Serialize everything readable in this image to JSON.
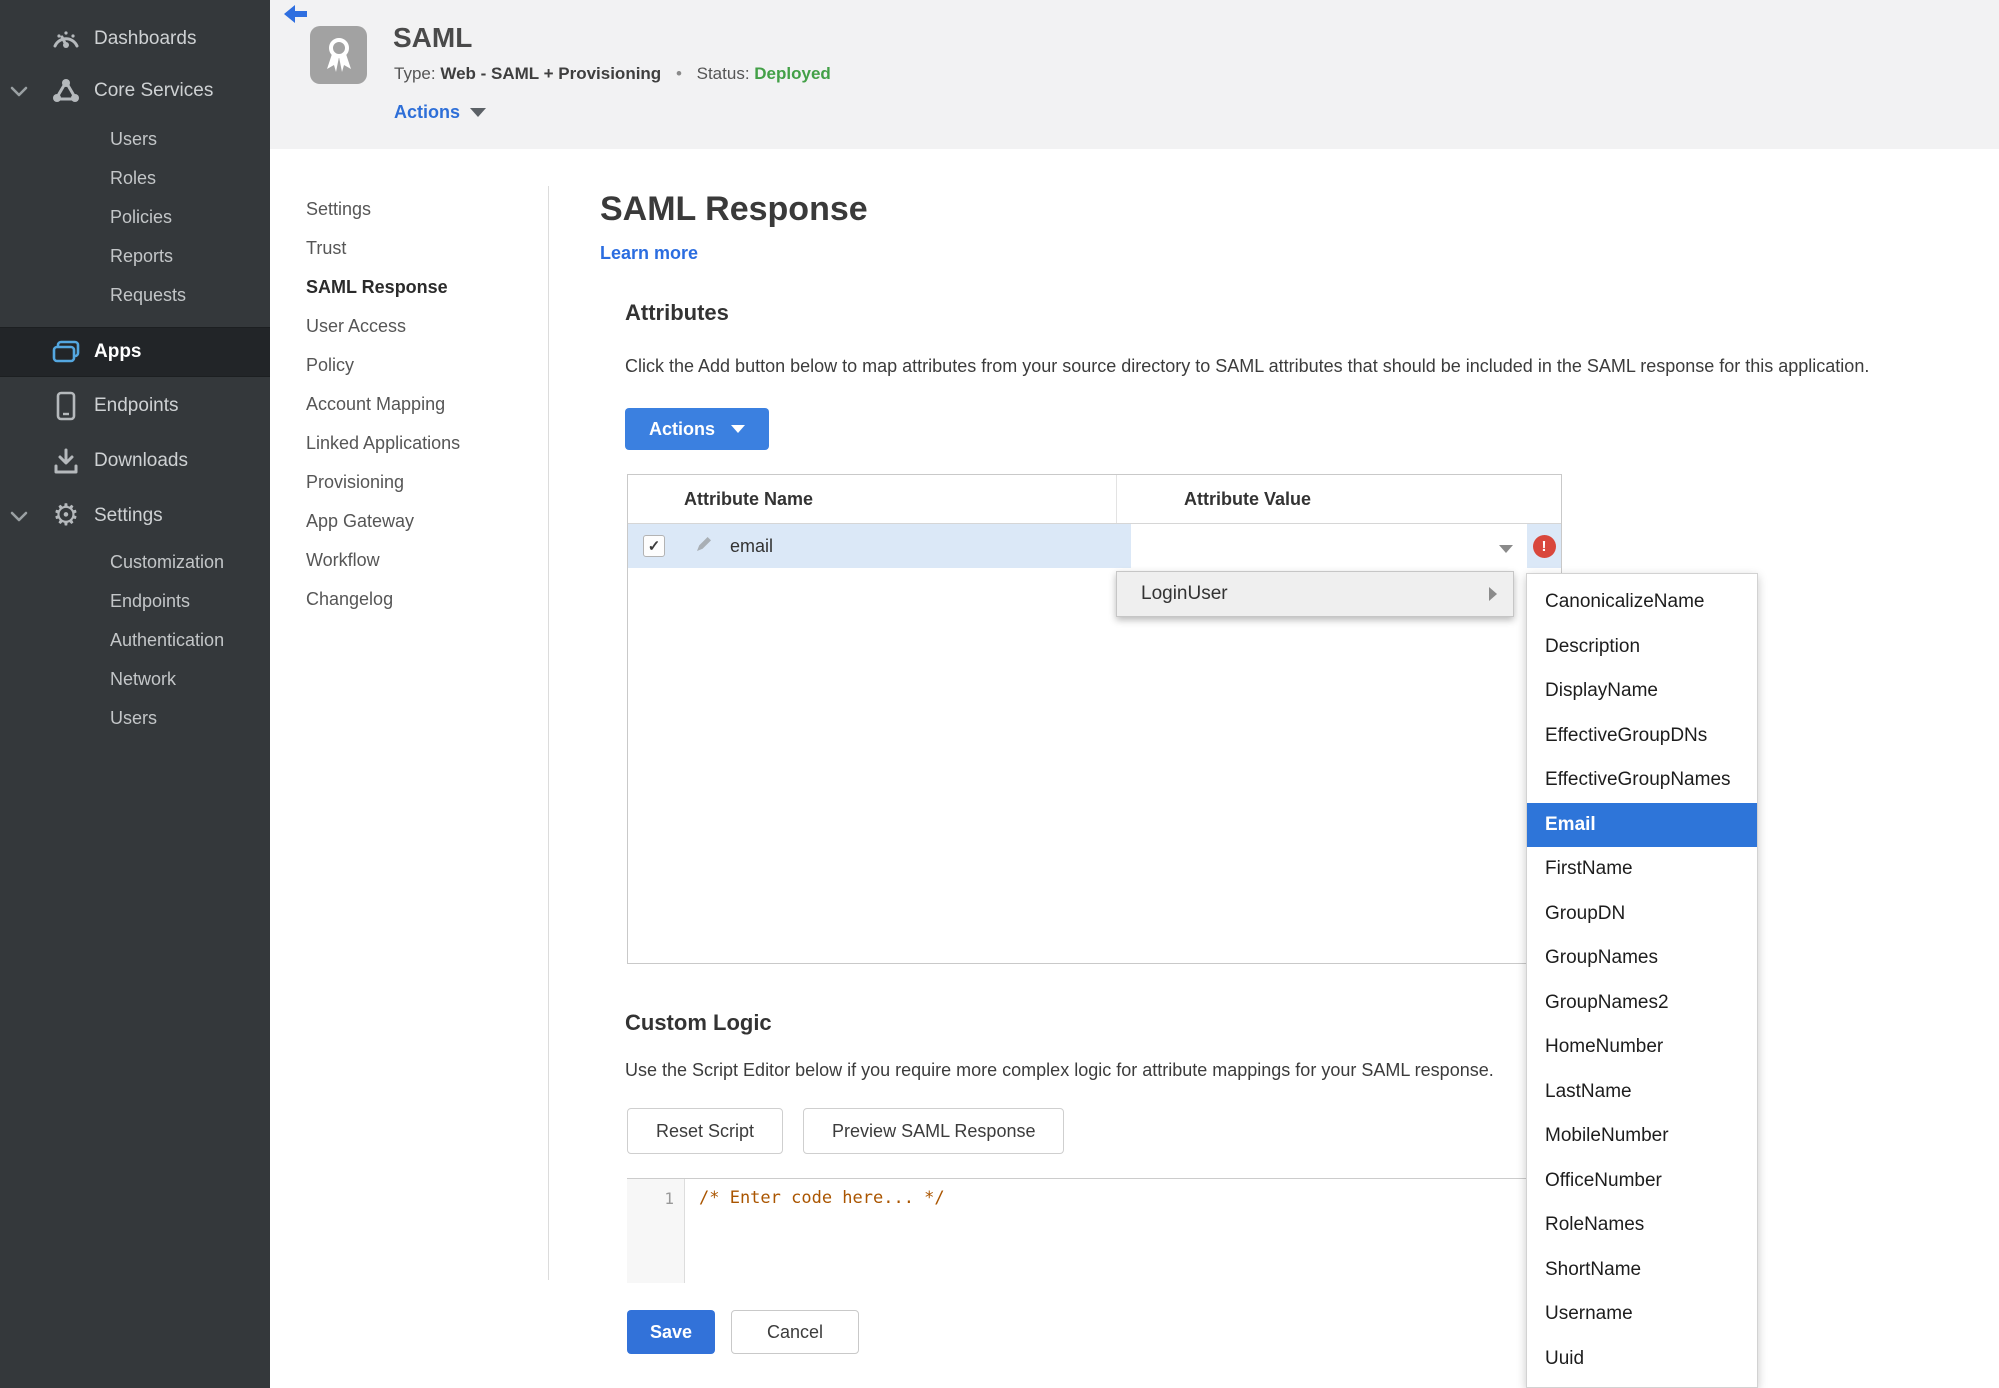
{
  "sidebar": {
    "items": {
      "dashboards": "Dashboards",
      "core_services": "Core Services",
      "apps": "Apps",
      "endpoints": "Endpoints",
      "downloads": "Downloads",
      "settings": "Settings"
    },
    "core_children": [
      "Users",
      "Roles",
      "Policies",
      "Reports",
      "Requests"
    ],
    "settings_children": [
      "Customization",
      "Endpoints",
      "Authentication",
      "Network",
      "Users"
    ],
    "icons": {
      "dashboards": "gauge-icon",
      "core_services": "nodes-icon",
      "apps": "app-windows-icon",
      "endpoints": "mobile-icon",
      "downloads": "download-icon",
      "settings": "gear-icon",
      "gear_glyph": "⚙"
    }
  },
  "header": {
    "title": "SAML",
    "type_label": "Type:",
    "type_value": "Web - SAML + Provisioning",
    "separator": "•",
    "status_label": "Status:",
    "status_value": "Deployed",
    "actions_label": "Actions",
    "icons": {
      "back": "back-arrow-icon",
      "badge": "award-ribbon-icon"
    }
  },
  "subnav": {
    "items": [
      "Settings",
      "Trust",
      "SAML Response",
      "User Access",
      "Policy",
      "Account Mapping",
      "Linked Applications",
      "Provisioning",
      "App Gateway",
      "Workflow",
      "Changelog"
    ],
    "active": "SAML Response"
  },
  "main": {
    "title": "SAML Response",
    "learn_more": "Learn more",
    "attributes": {
      "heading": "Attributes",
      "description": "Click the Add button below to map attributes from your source directory to SAML attributes that should be included in the SAML response for this application.",
      "actions_button": "Actions",
      "columns": {
        "name": "Attribute Name",
        "value": "Attribute Value"
      },
      "row": {
        "name": "email",
        "value": "",
        "check_glyph": "✓",
        "error_glyph": "!"
      }
    },
    "menu": {
      "label": "LoginUser"
    },
    "submenu": {
      "items": [
        "CanonicalizeName",
        "Description",
        "DisplayName",
        "EffectiveGroupDNs",
        "EffectiveGroupNames",
        "Email",
        "FirstName",
        "GroupDN",
        "GroupNames",
        "GroupNames2",
        "HomeNumber",
        "LastName",
        "MobileNumber",
        "OfficeNumber",
        "RoleNames",
        "ShortName",
        "Username",
        "Uuid"
      ],
      "selected": "Email"
    },
    "custom_logic": {
      "heading": "Custom Logic",
      "description": "Use the Script Editor below if you require more complex logic for attribute mappings for your SAML response.",
      "reset_button": "Reset Script",
      "preview_button": "Preview SAML Response"
    },
    "editor": {
      "line_number": "1",
      "code": "/* Enter code here... */"
    },
    "save_button": "Save",
    "cancel_button": "Cancel"
  },
  "colors": {
    "accent_blue": "#3272d9",
    "status_green": "#43a047",
    "error_red": "#d9473c",
    "selected_row_blue": "#dbe8f7",
    "sidebar_dark": "#34383b",
    "code_comment": "#aa5500"
  }
}
